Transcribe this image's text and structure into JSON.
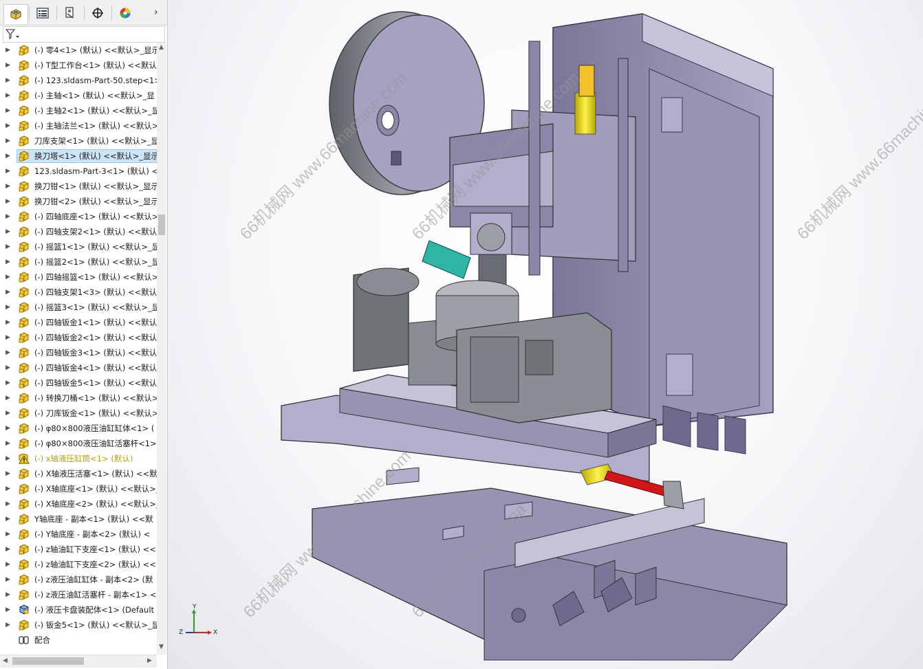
{
  "tabs": [
    {
      "name": "feature-manager-tab-icon"
    },
    {
      "name": "property-manager-tab-icon"
    },
    {
      "name": "configuration-manager-tab-icon"
    },
    {
      "name": "dimxpert-manager-tab-icon"
    },
    {
      "name": "display-manager-tab-icon"
    }
  ],
  "tab_more": "›",
  "filter_icon": "funnel-icon",
  "tree": [
    {
      "label": "(-) 零4<1> (默认) <<默认>_显示",
      "icon": "part"
    },
    {
      "label": "(-) T型工作台<1> (默认) <<默认>",
      "icon": "part"
    },
    {
      "label": "(-) 123.sldasm-Part-50.step<1>",
      "icon": "part"
    },
    {
      "label": "(-) 主轴<1> (默认) <<默认>_显",
      "icon": "part"
    },
    {
      "label": "(-) 主轴2<1> (默认) <<默认>_显",
      "icon": "part"
    },
    {
      "label": "(-) 主轴法兰<1> (默认) <<默认>",
      "icon": "part"
    },
    {
      "label": "刀库支架<1> (默认) <<默认>_显",
      "icon": "part"
    },
    {
      "label": "换刀塔<1> (默认) <<默认>_显示",
      "icon": "part",
      "selected": true
    },
    {
      "label": "123.sldasm-Part-3<1> (默认) <",
      "icon": "part"
    },
    {
      "label": "换刀钳<1> (默认) <<默认>_显示",
      "icon": "part"
    },
    {
      "label": "换刀钳<2> (默认) <<默认>_显示",
      "icon": "part"
    },
    {
      "label": "(-) 四轴底座<1> (默认) <<默认>",
      "icon": "part"
    },
    {
      "label": "(-) 四轴支架2<1> (默认) <<默认>",
      "icon": "part"
    },
    {
      "label": "(-) 摇篮1<1> (默认) <<默认>_显",
      "icon": "part"
    },
    {
      "label": "(-) 摇篮2<1> (默认) <<默认>_显",
      "icon": "part"
    },
    {
      "label": "(-) 四轴摇篮<1> (默认) <<默认>",
      "icon": "part"
    },
    {
      "label": "(-) 四轴支架1<3> (默认) <<默认>",
      "icon": "part"
    },
    {
      "label": "(-) 摇篮3<1> (默认) <<默认>_显",
      "icon": "part"
    },
    {
      "label": "(-) 四轴钣金1<1> (默认) <<默认>",
      "icon": "part"
    },
    {
      "label": "(-) 四轴钣金2<1> (默认) <<默认>",
      "icon": "part"
    },
    {
      "label": "(-) 四轴钣金3<1> (默认) <<默认>",
      "icon": "part"
    },
    {
      "label": "(-) 四轴钣金4<1> (默认) <<默认>",
      "icon": "part"
    },
    {
      "label": "(-) 四轴钣金5<1> (默认) <<默认>",
      "icon": "part"
    },
    {
      "label": "(-) 转换刀桶<1> (默认) <<默认>",
      "icon": "part"
    },
    {
      "label": "(-) 刀库钣金<1> (默认) <<默认>",
      "icon": "part"
    },
    {
      "label": "(-) φ80×800液压油缸缸体<1> (",
      "icon": "part"
    },
    {
      "label": "(-) φ80×800液压油缸活塞杆<1> (",
      "icon": "part"
    },
    {
      "label": "(-) x轴液压缸筒<1> (默认)",
      "icon": "warn",
      "warn": true
    },
    {
      "label": "(-) X轴液压活塞<1> (默认) <<默",
      "icon": "part"
    },
    {
      "label": "(-) X轴底座<1> (默认) <<默认>_",
      "icon": "part"
    },
    {
      "label": "(-) X轴底座<2> (默认) <<默认>_",
      "icon": "part"
    },
    {
      "label": "Y轴底座 - 副本<1> (默认) <<默",
      "icon": "part"
    },
    {
      "label": "(-) Y轴底座 - 副本<2> (默认) <",
      "icon": "part"
    },
    {
      "label": "(-) z轴油缸下支座<1> (默认) <<",
      "icon": "part"
    },
    {
      "label": "(-) z轴油缸下支座<2> (默认) <<",
      "icon": "part"
    },
    {
      "label": "(-) z液压油缸缸体 - 副本<2> (默",
      "icon": "part"
    },
    {
      "label": "(-) z液压油缸活塞杆 - 副本<1> <",
      "icon": "part"
    },
    {
      "label": "(-) 液压卡盘装配体<1> (Default",
      "icon": "asm"
    },
    {
      "label": "(-) 钣金5<1> (默认) <<默认>_显",
      "icon": "part"
    },
    {
      "label": "配合",
      "icon": "mates",
      "noexp": true
    }
  ],
  "watermarks": [
    "66机械网 www.66machine.com",
    "66机械网 www.66machine.com",
    "66机械网 www.66machine.com",
    "66机械网 www.66machine.com",
    "66机械网 www.66ma"
  ],
  "triad_labels": {
    "x": "X",
    "y": "Y",
    "z": "Z"
  },
  "colors": {
    "machine_body": "#8c86a8",
    "machine_light": "#b3aecb",
    "machine_dark": "#5c5776",
    "gray_metal": "#9aa0a6",
    "teal": "#2fb5a6",
    "yellow": "#e8d800",
    "red": "#d01818",
    "selection": "#cce4f7"
  }
}
